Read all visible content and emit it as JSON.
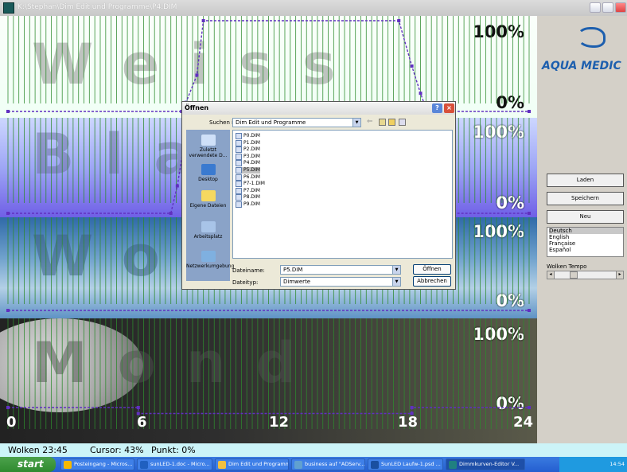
{
  "window": {
    "title": "K:\\Stephan\\Dim Edit und Programme\\P4.DIM"
  },
  "panels": [
    {
      "word": "Weiss",
      "pct_top": "100%",
      "pct_bottom": "0%"
    },
    {
      "word": "Blau",
      "pct_top": "100%",
      "pct_bottom": "0%"
    },
    {
      "word": "Wolken",
      "pct_top": "100%",
      "pct_bottom": "0%"
    },
    {
      "word": "Mond",
      "pct_top": "100%",
      "pct_bottom": "0%"
    }
  ],
  "xaxis": [
    "0",
    "6",
    "12",
    "18",
    "24"
  ],
  "sidebar": {
    "logo": "AQUA MEDIC",
    "buttons": [
      "Laden",
      "Speichern",
      "Neu"
    ],
    "languages": [
      "Deutsch",
      "English",
      "Française",
      "Español"
    ],
    "selected_language": "Deutsch",
    "tempo_label": "Wolken Tempo"
  },
  "status": {
    "clouds": "Wolken  23:45",
    "cursor": "Cursor: 43%",
    "point": "Punkt: 0%"
  },
  "dialog": {
    "title": "Öffnen",
    "look_in_label": "Suchen in:",
    "look_in_value": "Dim Edit und Programme",
    "places": [
      "Zuletzt verwendete D...",
      "Desktop",
      "Eigene Dateien",
      "Arbeitsplatz",
      "Netzwerkumgebung"
    ],
    "files": [
      "P0.DIM",
      "P1.DIM",
      "P2.DIM",
      "P3.DIM",
      "P4.DIM",
      "P5.DIM",
      "P6.DIM",
      "P7-1.DIM",
      "P7.DIM",
      "P8.DIM",
      "P9.DIM"
    ],
    "selected_file": "P5.DIM",
    "filename_label": "Dateiname:",
    "filename_value": "P5.DIM",
    "filetype_label": "Dateityp:",
    "filetype_value": "Dimwerte",
    "open_label": "Öffnen",
    "cancel_label": "Abbrechen"
  },
  "taskbar": {
    "start": "start",
    "tasks": [
      "Posteingang - Micros...",
      "sunLED-1.doc - Micro...",
      "Dim Edit und Programme",
      "business auf \"ADServ...",
      "SunLED Laufw-1.psd ...",
      "Dimmkurven-Editor V..."
    ],
    "clock": "14:54"
  },
  "colors": {
    "grid_line": "#2e8b2e",
    "curve": "#6030c0",
    "status_bg": "#ccf4f8",
    "taskbar": "#245ed0"
  }
}
